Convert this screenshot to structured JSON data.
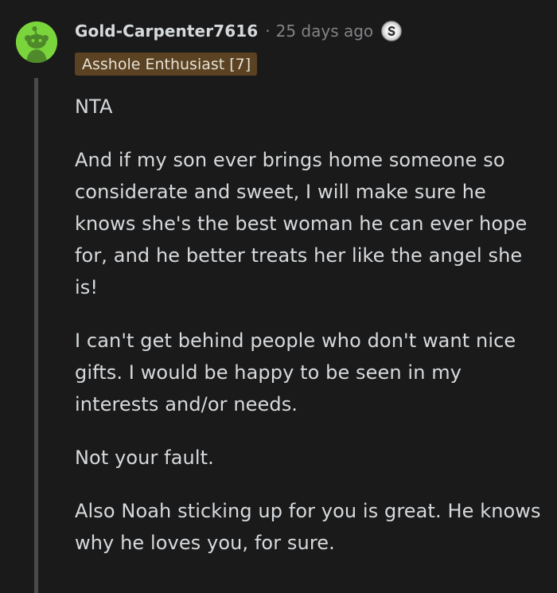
{
  "comment": {
    "username": "Gold-Carpenter7616",
    "separator": "·",
    "timestamp": "25 days ago",
    "flair": "Asshole Enthusiast [7]",
    "award_icon": "silver-award-icon",
    "avatar_icon": "snoo-avatar-icon",
    "paragraphs": [
      "NTA",
      "And if my son ever brings home someone so considerate and sweet, I will make sure he knows she's the best woman he can ever hope for, and he better treats her like the angel she is!",
      "I can't get behind people who don't want nice gifts. I would be happy to be seen in my interests and/or needs.",
      "Not your fault.",
      "Also Noah sticking up for you is great. He knows why he loves you, for sure."
    ]
  },
  "colors": {
    "background": "#1a1a1b",
    "text": "#d7dadc",
    "meta": "#818384",
    "avatar": "#7ad43c",
    "flair_bg": "#5a4222",
    "thread_line": "#4a4a4b"
  }
}
